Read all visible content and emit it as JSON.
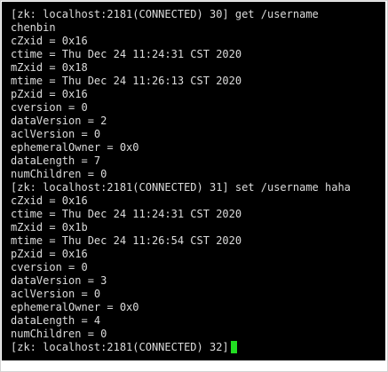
{
  "terminal": {
    "lines": [
      "[zk: localhost:2181(CONNECTED) 30] get /username",
      "chenbin",
      "cZxid = 0x16",
      "ctime = Thu Dec 24 11:24:31 CST 2020",
      "mZxid = 0x18",
      "mtime = Thu Dec 24 11:26:13 CST 2020",
      "pZxid = 0x16",
      "cversion = 0",
      "dataVersion = 2",
      "aclVersion = 0",
      "ephemeralOwner = 0x0",
      "dataLength = 7",
      "numChildren = 0",
      "[zk: localhost:2181(CONNECTED) 31] set /username haha",
      "cZxid = 0x16",
      "ctime = Thu Dec 24 11:24:31 CST 2020",
      "mZxid = 0x1b",
      "mtime = Thu Dec 24 11:26:54 CST 2020",
      "pZxid = 0x16",
      "cversion = 0",
      "dataVersion = 3",
      "aclVersion = 0",
      "ephemeralOwner = 0x0",
      "dataLength = 4",
      "numChildren = 0"
    ],
    "prompt": "[zk: localhost:2181(CONNECTED) 32]",
    "colors": {
      "background": "#000000",
      "text": "#dcdcdc",
      "cursor": "#22dd22"
    }
  }
}
